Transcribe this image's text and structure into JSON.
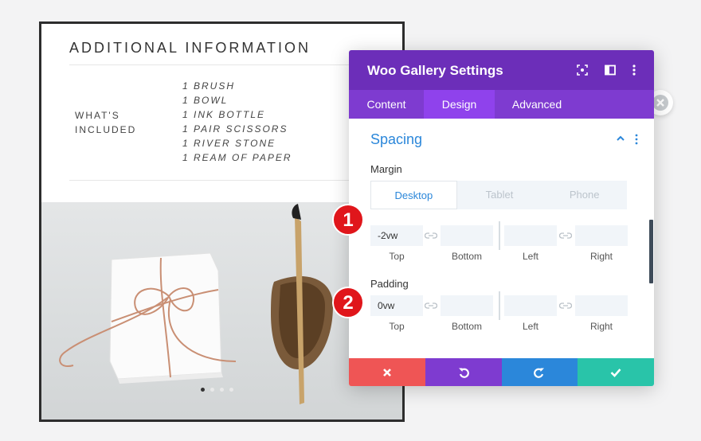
{
  "preview": {
    "heading": "ADDITIONAL INFORMATION",
    "included_label": "WHAT'S\nINCLUDED",
    "included_items": [
      "1 BRUSH",
      "1 BOWL",
      "1 INK BOTTLE",
      "1 PAIR SCISSORS",
      "1 RIVER STONE",
      "1 REAM OF PAPER"
    ],
    "slider_active_index": 0,
    "slider_count": 4
  },
  "modal": {
    "title": "Woo Gallery Settings",
    "tabs": [
      "Content",
      "Design",
      "Advanced"
    ],
    "active_tab": "Design",
    "section": "Spacing",
    "margin": {
      "label": "Margin",
      "devices": [
        "Desktop",
        "Tablet",
        "Phone"
      ],
      "active_device": "Desktop",
      "top": "-2vw",
      "bottom": "",
      "left": "",
      "right": ""
    },
    "padding": {
      "label": "Padding",
      "top": "0vw",
      "bottom": "",
      "left": "",
      "right": ""
    },
    "field_labels": [
      "Top",
      "Bottom",
      "Left",
      "Right"
    ],
    "icons": [
      "screenshot-icon",
      "split-view-icon",
      "kebab-menu-icon",
      "chevron-up-icon",
      "link-icon",
      "cancel-icon",
      "undo-icon",
      "redo-icon",
      "check-icon",
      "close-icon"
    ]
  },
  "badges": [
    "1",
    "2"
  ],
  "colors": {
    "header": "#6c2eb9",
    "tabs": "#7e3bd0",
    "active_tab": "#8f42ec",
    "accent_blue": "#2b87da",
    "cancel": "#ef5555",
    "undo": "#7e3bd0",
    "redo": "#2b87da",
    "save": "#29c4a9",
    "badge": "#e0161b"
  }
}
